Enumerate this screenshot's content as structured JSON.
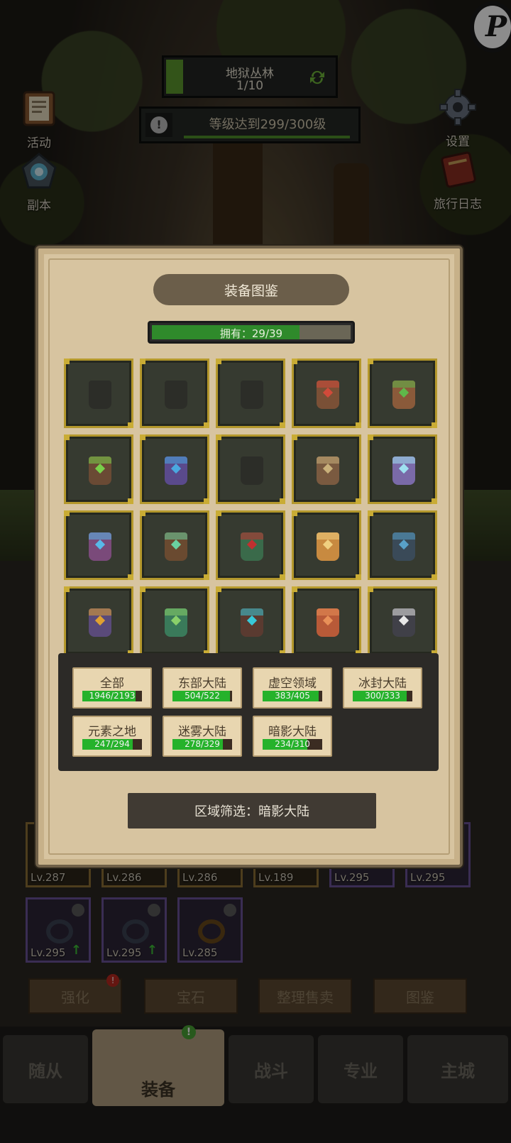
{
  "hud": {
    "stage_name": "地狱丛林",
    "stage_progress": "1/10",
    "stage_fill": 0.1,
    "quest_text": "等级达到299/300级",
    "quest_fill": 0.99,
    "quest_alert": "!"
  },
  "side_left": [
    {
      "label": "活动",
      "icon": "event-board-icon"
    },
    {
      "label": "副本",
      "icon": "portal-icon"
    }
  ],
  "side_right": [
    {
      "label": "设置",
      "icon": "gear-icon"
    },
    {
      "label": "旅行日志",
      "icon": "journal-icon"
    }
  ],
  "background_equipment": [
    {
      "level": "Lv.287"
    },
    {
      "level": "Lv.286"
    },
    {
      "level": "Lv.286"
    },
    {
      "level": "Lv.189"
    },
    {
      "level": "Lv.295"
    },
    {
      "level": "Lv.295"
    },
    {
      "level": "Lv.295"
    },
    {
      "level": "Lv.295"
    },
    {
      "level": "Lv.285"
    }
  ],
  "actions": [
    {
      "label": "强化",
      "badge": "!"
    },
    {
      "label": "宝石"
    },
    {
      "label": "整理售卖"
    },
    {
      "label": "图鉴"
    }
  ],
  "tabs": [
    {
      "label": "随从"
    },
    {
      "label": "装备",
      "badge": "!"
    },
    {
      "label": "战斗"
    },
    {
      "label": "专业"
    },
    {
      "label": "主城"
    }
  ],
  "codex": {
    "title": "装备图鉴",
    "owned_text": "拥有：29/39",
    "owned_fraction": 0.744,
    "items": [
      {
        "state": "unknown"
      },
      {
        "state": "unknown"
      },
      {
        "state": "unknown"
      },
      {
        "state": "owned",
        "color": "#7a5036",
        "accent": "#d14a3a"
      },
      {
        "state": "owned",
        "color": "#8a5a3a",
        "accent": "#5fb84a"
      },
      {
        "state": "owned",
        "color": "#6a4a34",
        "accent": "#78d04a"
      },
      {
        "state": "owned",
        "color": "#5a4a8c",
        "accent": "#4aa8e0"
      },
      {
        "state": "unknown"
      },
      {
        "state": "owned",
        "color": "#7a5a40",
        "accent": "#c9b07a"
      },
      {
        "state": "owned",
        "color": "#7a6aa8",
        "accent": "#9ee0f0"
      },
      {
        "state": "owned",
        "color": "#7a4a7a",
        "accent": "#58b8e8"
      },
      {
        "state": "owned",
        "color": "#6a4a30",
        "accent": "#6ad0a0"
      },
      {
        "state": "owned",
        "color": "#3a6a4a",
        "accent": "#c03030"
      },
      {
        "state": "owned",
        "color": "#c88a40",
        "accent": "#f0d080"
      },
      {
        "state": "owned",
        "color": "#3a4a58",
        "accent": "#58a0c8"
      },
      {
        "state": "owned",
        "color": "#5a4a7a",
        "accent": "#e0a030"
      },
      {
        "state": "owned",
        "color": "#3a7a5a",
        "accent": "#8ad06a"
      },
      {
        "state": "owned",
        "color": "#5a3a30",
        "accent": "#38c8d8"
      },
      {
        "state": "owned",
        "color": "#b85a38",
        "accent": "#e89058"
      },
      {
        "state": "owned",
        "color": "#404048",
        "accent": "#e8e8e8"
      }
    ],
    "filters": [
      {
        "name": "全部",
        "count": "1946/2193",
        "fraction": 0.887
      },
      {
        "name": "东部大陆",
        "count": "504/522",
        "fraction": 0.966
      },
      {
        "name": "虚空领域",
        "count": "383/405",
        "fraction": 0.946
      },
      {
        "name": "冰封大陆",
        "count": "300/333",
        "fraction": 0.901
      },
      {
        "name": "元素之地",
        "count": "247/294",
        "fraction": 0.84
      },
      {
        "name": "迷雾大陆",
        "count": "278/329",
        "fraction": 0.845
      },
      {
        "name": "暗影大陆",
        "count": "234/310",
        "fraction": 0.755
      }
    ],
    "region_filter_label": "区域筛选：暗影大陆"
  },
  "edge_logo": "P"
}
